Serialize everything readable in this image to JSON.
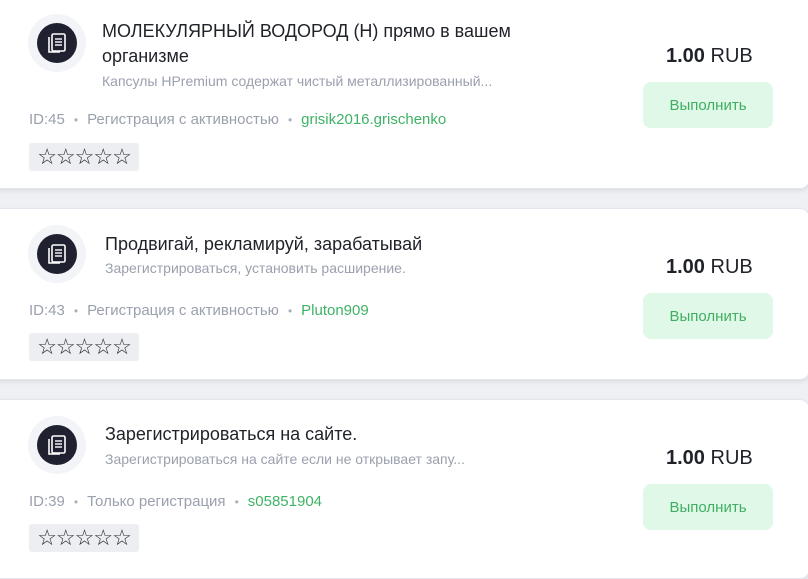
{
  "tasks": [
    {
      "title": "МОЛЕКУЛЯРНЫЙ ВОДОРОД (Н) прямо в вашем организме",
      "description": "Капсулы HPremium содержат чистый металлизированный...",
      "id": "ID:45",
      "type": "Регистрация с активностью",
      "user": "grisik2016.grischenko",
      "rating_stars": "☆☆☆☆☆",
      "price_amount": "1.00",
      "price_currency": "RUB",
      "button_label": "Выполнить"
    },
    {
      "title": "Продвигай, рекламируй, зарабатывай",
      "description": "Зарегистрироваться, установить расширение.",
      "id": "ID:43",
      "type": "Регистрация с активностью",
      "user": "Pluton909",
      "rating_stars": "☆☆☆☆☆",
      "price_amount": "1.00",
      "price_currency": "RUB",
      "button_label": "Выполнить"
    },
    {
      "title": "Зарегистрироваться на сайте.",
      "description": "Зарегистрироваться на сайте если не открывает запу...",
      "id": "ID:39",
      "type": "Только регистрация",
      "user": "s05851904",
      "rating_stars": "☆☆☆☆☆",
      "price_amount": "1.00",
      "price_currency": "RUB",
      "button_label": "Выполнить"
    }
  ],
  "meta_separator": "•",
  "icon": "task-document-icon",
  "colors": {
    "accent_green": "#3fb266",
    "button_bg": "#e0f8e7",
    "icon_dark": "#1f2030"
  }
}
